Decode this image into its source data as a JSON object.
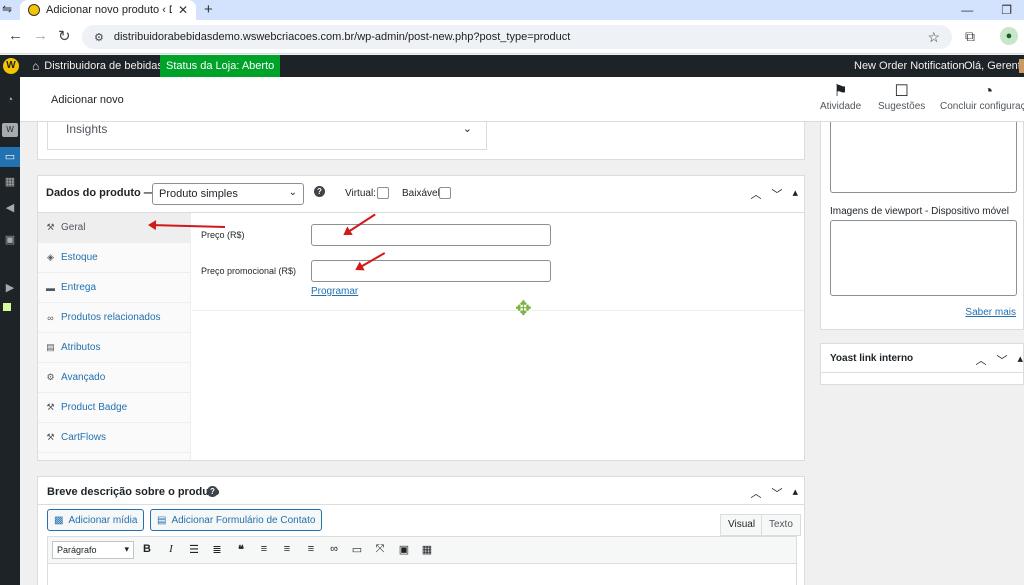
{
  "browser": {
    "tab_title": "Adicionar novo produto ‹ Distri",
    "new_tab": "+",
    "url": "distribuidorabebidasdemo.wswebcriacoes.com.br/wp-admin/post-new.php?post_type=product"
  },
  "adminbar": {
    "site_name": "Distribuidora de bebidas",
    "store_status": "Status da Loja: Aberto",
    "new_order": "New Order Notification",
    "greeting": "Olá, Gerente"
  },
  "wc_header": {
    "title": "Adicionar novo",
    "actions": [
      {
        "label": "Atividade",
        "icon": "flag-icon"
      },
      {
        "label": "Sugestões",
        "icon": "feedback-icon"
      },
      {
        "label": "Concluir configuração",
        "icon": "progress-ring-icon"
      }
    ]
  },
  "insights": {
    "label": "Insights"
  },
  "product_data": {
    "title": "Dados do produto —",
    "product_type": "Produto simples",
    "virtual_label": "Virtual:",
    "downloadable_label": "Baixável:",
    "tabs": [
      {
        "label": "Geral",
        "icon": "wrench-icon"
      },
      {
        "label": "Estoque",
        "icon": "tag-icon"
      },
      {
        "label": "Entrega",
        "icon": "truck-icon"
      },
      {
        "label": "Produtos relacionados",
        "icon": "link-icon"
      },
      {
        "label": "Atributos",
        "icon": "table-icon"
      },
      {
        "label": "Avançado",
        "icon": "gear-icon"
      },
      {
        "label": "Product Badge",
        "icon": "wrench-icon"
      },
      {
        "label": "CartFlows",
        "icon": "wrench-icon"
      }
    ],
    "fields": {
      "price_label": "Preço (R$)",
      "price_value": "",
      "sale_price_label": "Preço promocional (R$)",
      "sale_price_value": "",
      "schedule_link": "Programar"
    }
  },
  "short_description": {
    "title": "Breve descrição sobre o produto",
    "add_media": "Adicionar mídia",
    "add_form": "Adicionar Formulário de Contato",
    "tab_visual": "Visual",
    "tab_text": "Texto",
    "format_select": "Parágrafo",
    "toolbar": [
      "bold-icon",
      "italic-icon",
      "bullet-list-icon",
      "numbered-list-icon",
      "blockquote-icon",
      "align-left-icon",
      "align-center-icon",
      "align-right-icon",
      "link-icon",
      "read-more-icon",
      "fullscreen-icon",
      "toolbar-toggle-icon",
      "keyboard-icon"
    ]
  },
  "right_sidebar": {
    "viewport_label": "Imagens de viewport - Dispositivo móvel",
    "learn_more": "Saber mais",
    "yoast_title": "Yoast link interno"
  },
  "colors": {
    "admin_dark": "#1d2327",
    "wp_blue": "#2271b1",
    "status_green": "#00a32a",
    "annotation_red": "#d21919",
    "move_green": "#7cb342"
  }
}
